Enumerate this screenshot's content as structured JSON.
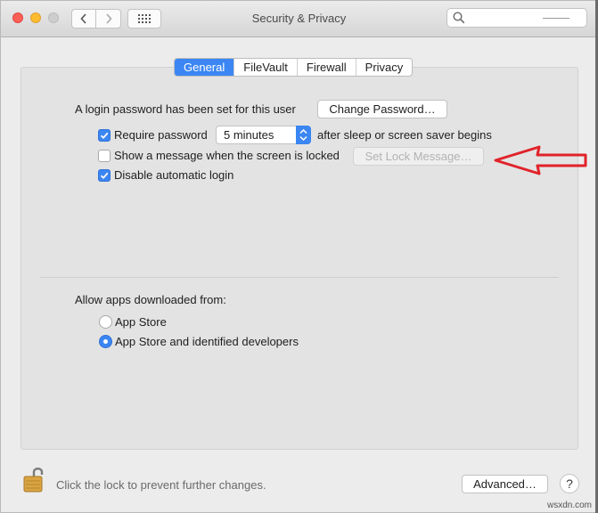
{
  "window": {
    "title": "Security & Privacy",
    "search_placeholder": ""
  },
  "tabs": [
    {
      "label": "General",
      "active": true
    },
    {
      "label": "FileVault",
      "active": false
    },
    {
      "label": "Firewall",
      "active": false
    },
    {
      "label": "Privacy",
      "active": false
    }
  ],
  "general": {
    "login_password_text": "A login password has been set for this user",
    "change_password_label": "Change Password…",
    "require_password": {
      "label": "Require password",
      "checked": true
    },
    "require_password_delay": "5 minutes",
    "require_password_suffix": "after sleep or screen saver begins",
    "show_message": {
      "label": "Show a message when the screen is locked",
      "checked": false
    },
    "set_lock_message_label": "Set Lock Message…",
    "disable_auto_login": {
      "label": "Disable automatic login",
      "checked": true
    }
  },
  "downloads": {
    "heading": "Allow apps downloaded from:",
    "options": [
      {
        "label": "App Store",
        "selected": false
      },
      {
        "label": "App Store and identified developers",
        "selected": true
      }
    ]
  },
  "footer": {
    "lock_text": "Click the lock to prevent further changes.",
    "advanced_label": "Advanced…",
    "help_label": "?"
  },
  "watermark": "wsxdn.com",
  "colors": {
    "accent": "#3b86f3",
    "annotation_arrow": "#e0232a"
  }
}
